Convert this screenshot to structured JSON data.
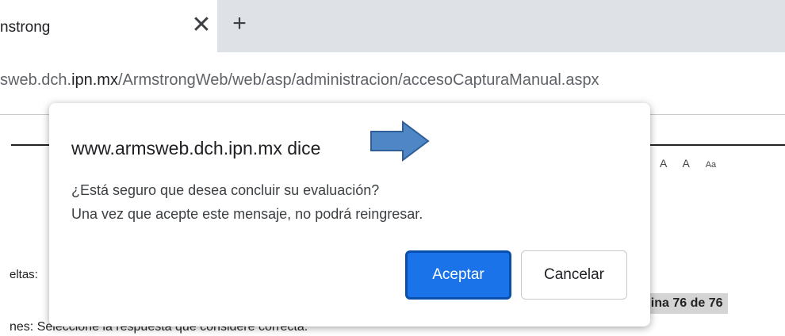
{
  "browser": {
    "tab_title": "nstrong",
    "close_glyph": "✕",
    "new_tab_glyph": "+",
    "url_prefix": "sweb.dch.",
    "url_host": "ipn.mx",
    "url_path": "/ArmstrongWeb/web/asp/administracion/accesoCapturaManual.aspx"
  },
  "page": {
    "font_controls": [
      "A",
      "A",
      "Aa"
    ],
    "label": "eltas:",
    "pagina": "gina 76 de 76",
    "instrucciones": "nes: Seleccione la respuesta que considere correcta."
  },
  "dialog": {
    "title": "www.armsweb.dch.ipn.mx dice",
    "message_line1": "¿Está seguro que desea concluir su evaluación?",
    "message_line2": "Una vez que acepte este mensaje, no podrá reingresar.",
    "ok_label": "Aceptar",
    "cancel_label": "Cancelar"
  },
  "colors": {
    "accent": "#1a73e8",
    "arrow": "#4f86c6"
  }
}
